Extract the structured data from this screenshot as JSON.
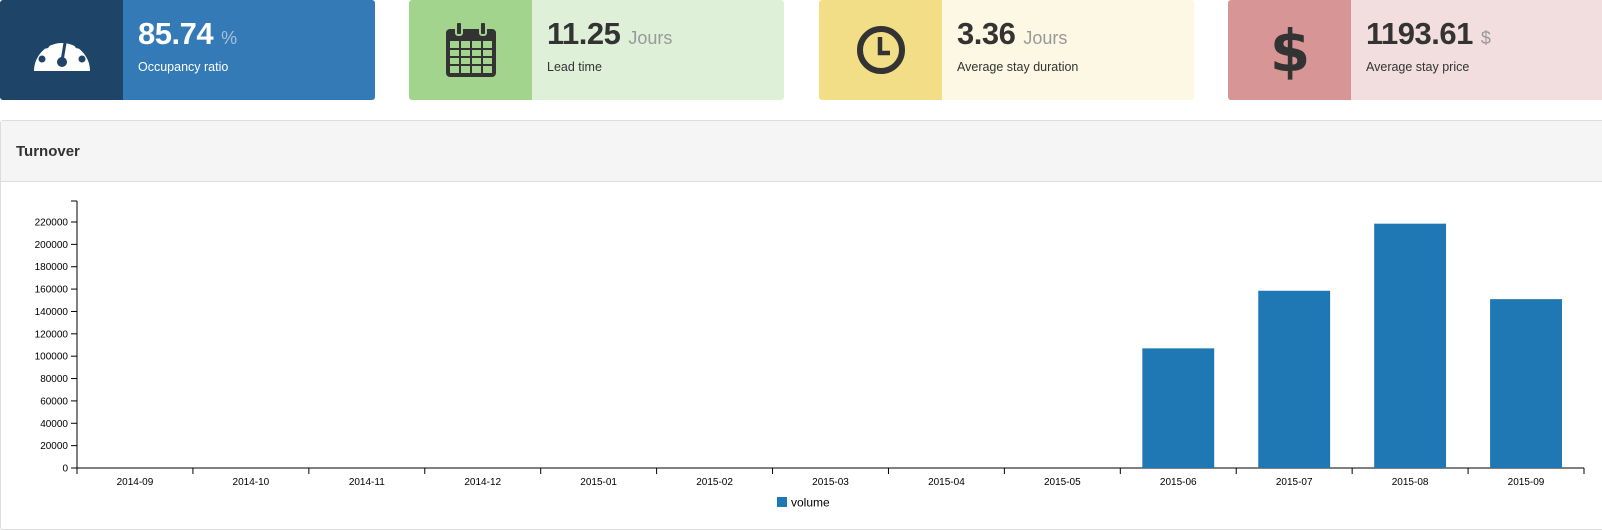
{
  "stats": [
    {
      "value": "85.74",
      "unit": "%",
      "label": "Occupancy ratio",
      "icon": "dashboard-icon"
    },
    {
      "value": "11.25",
      "unit": "Jours",
      "label": "Lead time",
      "icon": "calendar-icon"
    },
    {
      "value": "3.36",
      "unit": "Jours",
      "label": "Average stay duration",
      "icon": "clock-icon"
    },
    {
      "value": "1193.61",
      "unit": "$",
      "label": "Average stay price",
      "icon": "dollar-icon"
    }
  ],
  "panel": {
    "title": "Turnover"
  },
  "chart_data": {
    "type": "bar",
    "title": "",
    "xlabel": "",
    "ylabel": "",
    "categories": [
      "2014-09",
      "2014-10",
      "2014-11",
      "2014-12",
      "2015-01",
      "2015-02",
      "2015-03",
      "2015-04",
      "2015-05",
      "2015-06",
      "2015-07",
      "2015-08",
      "2015-09"
    ],
    "series": [
      {
        "name": "volume",
        "values": [
          0,
          0,
          0,
          0,
          0,
          0,
          0,
          0,
          0,
          107000,
          158500,
          218500,
          151000
        ],
        "color": "#1f77b4"
      }
    ],
    "y_ticks": [
      "0",
      "20000",
      "40000",
      "60000",
      "80000",
      "100000",
      "120000",
      "140000",
      "160000",
      "180000",
      "200000",
      "220000"
    ],
    "ylim": [
      0,
      240000
    ],
    "grid": false,
    "legend": "bottom-center"
  }
}
